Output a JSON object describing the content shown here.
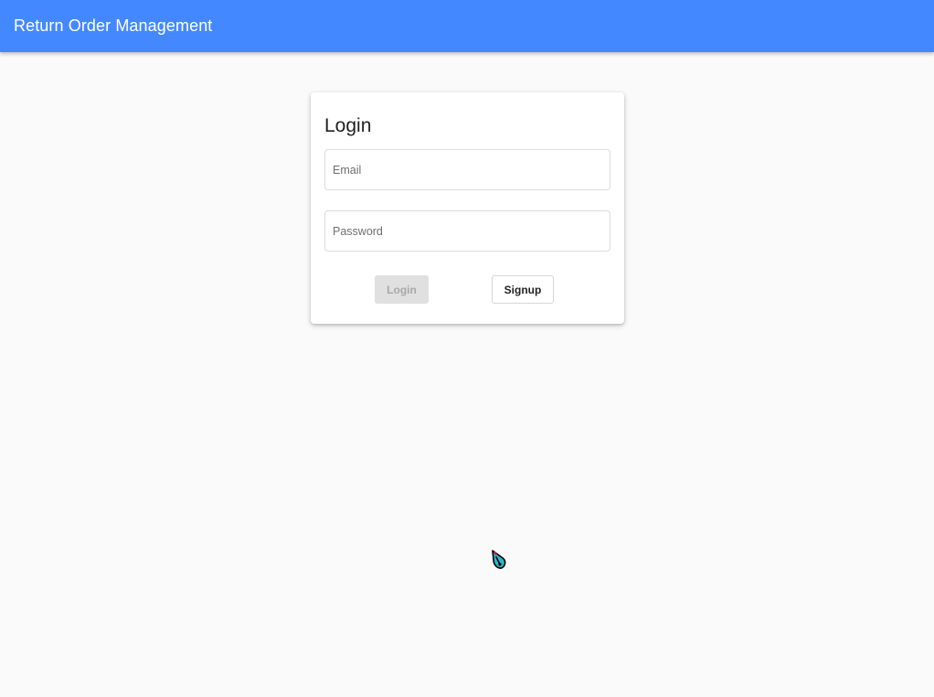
{
  "app": {
    "title": "Return Order Management"
  },
  "login_card": {
    "heading": "Login",
    "email": {
      "placeholder": "Email",
      "value": ""
    },
    "password": {
      "placeholder": "Password",
      "value": ""
    },
    "login_button_label": "Login",
    "login_button_state": "disabled",
    "signup_button_label": "Signup"
  },
  "colors": {
    "toolbar": "#4488ff",
    "background": "#fafafa",
    "card": "#ffffff",
    "disabled_button": "#e0e0e0"
  },
  "icons": {
    "cursor": "pointer-cursor-icon"
  }
}
